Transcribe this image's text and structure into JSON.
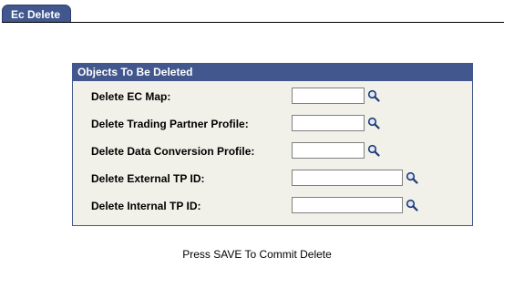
{
  "tab": {
    "label": "Ec Delete"
  },
  "group": {
    "title": "Objects To Be Deleted",
    "fields": [
      {
        "label": "Delete EC Map:",
        "value": ""
      },
      {
        "label": "Delete Trading Partner Profile:",
        "value": ""
      },
      {
        "label": "Delete Data Conversion Profile:",
        "value": ""
      },
      {
        "label": "Delete External TP ID:",
        "value": ""
      },
      {
        "label": "Delete Internal TP ID:",
        "value": ""
      }
    ]
  },
  "footer": {
    "note": "Press SAVE To Commit Delete"
  },
  "icons": {
    "lookup": "magnifier-lookup-icon"
  },
  "colors": {
    "header_blue": "#41578e",
    "panel_background": "#f1f1e9"
  }
}
